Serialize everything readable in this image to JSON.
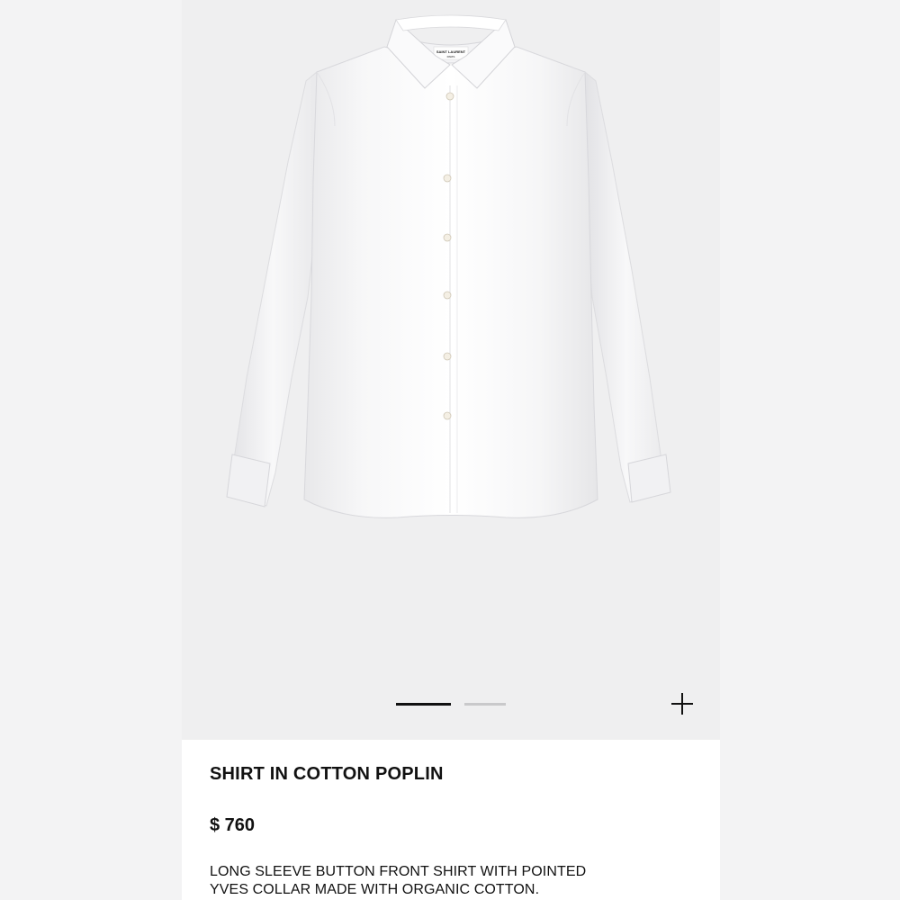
{
  "product": {
    "title": "SHIRT IN COTTON POPLIN",
    "price": "$ 760",
    "description_line1": "LONG SLEEVE BUTTON FRONT SHIRT WITH POINTED",
    "description_line2": "YVES COLLAR MADE WITH ORGANIC COTTON.",
    "label_brand": "SAINT LAURENT",
    "label_city": "PARIS"
  },
  "gallery": {
    "image_count": 2,
    "active_index": 0,
    "zoom_icon": "plus-icon"
  },
  "colors": {
    "background": "#efeff0",
    "text": "#111111",
    "pager_active": "#111111",
    "pager_inactive": "#c9c9cb"
  }
}
